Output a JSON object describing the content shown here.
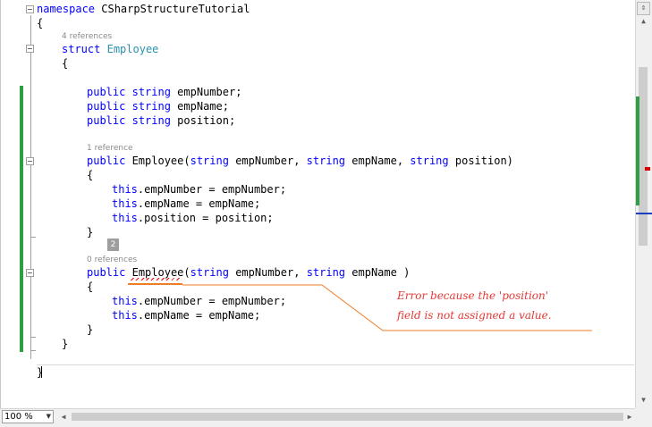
{
  "code": {
    "namespace_kw": "namespace",
    "namespace_name": " CSharpStructureTutorial",
    "open_brace_ns": "{",
    "lens_struct": "4 references",
    "struct_kw": "struct",
    "struct_name": "Employee",
    "open_brace_struct": "{",
    "fields": [
      {
        "kw": "public",
        "type": "string",
        "name": " empNumber;"
      },
      {
        "kw": "public",
        "type": "string",
        "name": " empName;"
      },
      {
        "kw": "public",
        "type": "string",
        "name": " position;"
      }
    ],
    "lens_ctor1": "1 reference",
    "ctor1": {
      "kw": "public",
      "name": " Employee(",
      "p1type": "string",
      "p1": " empNumber, ",
      "p2type": "string",
      "p2": " empName, ",
      "p3type": "string",
      "p3": " position)"
    },
    "ctor1_open": "{",
    "ctor1_body": [
      {
        "this": "this",
        "rest": ".empNumber = empNumber;"
      },
      {
        "this": "this",
        "rest": ".empName = empName;"
      },
      {
        "this": "this",
        "rest": ".position = position;"
      }
    ],
    "ctor1_close": "}",
    "badge": "2",
    "lens_ctor2": "0 references",
    "ctor2": {
      "kw": "public",
      "name": "Employee",
      "open": "(",
      "p1type": "string",
      "p1": " empNumber, ",
      "p2type": "string",
      "p2": " empName )"
    },
    "ctor2_open": "{",
    "ctor2_body": [
      {
        "this": "this",
        "rest": ".empNumber = empNumber;"
      },
      {
        "this": "this",
        "rest": ".empName = empName;"
      }
    ],
    "ctor2_close": "}",
    "struct_close": "}",
    "ns_close": "}"
  },
  "annotation": {
    "line1": "Error because the 'position'",
    "line2": "field is not assigned a value."
  },
  "statusbar": {
    "zoom": "100 %"
  },
  "colors": {
    "keyword": "#0000ff",
    "type": "#2b91af",
    "change_bar": "#2ea043",
    "error": "#e53935"
  },
  "icons": [
    "fold-collapse-icon",
    "split-window-icon",
    "scroll-up-arrow-icon",
    "scroll-down-arrow-icon",
    "scroll-left-arrow-icon",
    "scroll-right-arrow-icon",
    "dropdown-arrow-icon"
  ]
}
